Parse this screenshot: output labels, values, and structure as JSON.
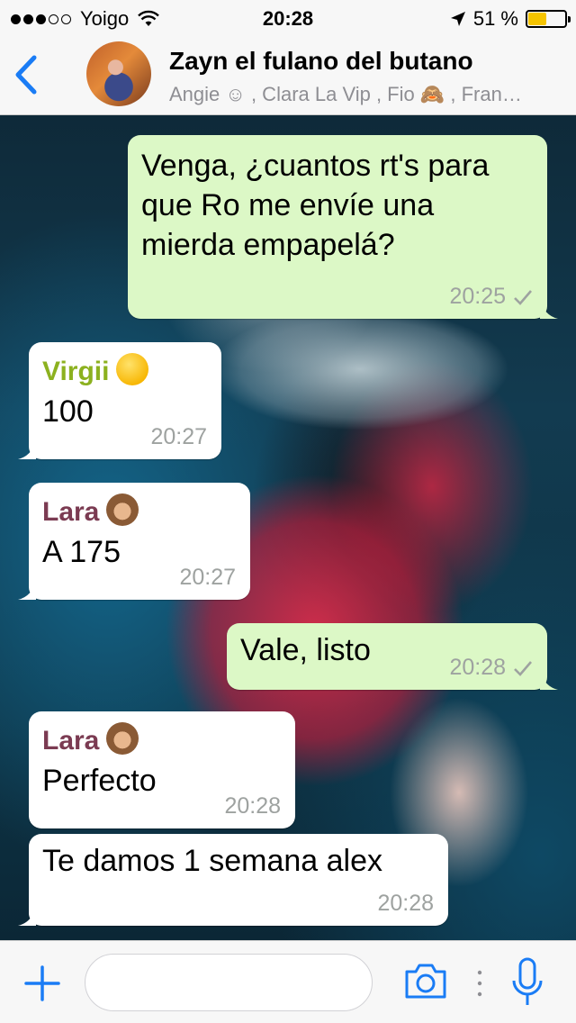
{
  "status_bar": {
    "carrier": "Yoigo",
    "time": "20:28",
    "battery_percent": "51 %",
    "battery_level": 0.51,
    "signal_bars_filled": 3,
    "signal_bars_total": 5
  },
  "header": {
    "title": "Zayn el fulano del butano",
    "participants": "Angie ☺︎ , Clara La Vip , Fio 🙈 , Fran…"
  },
  "messages": [
    {
      "direction": "out",
      "text": "Venga, ¿cuantos rt's para que Ro me envíe una mierda empapelá?",
      "time": "20:25",
      "status": "sent"
    },
    {
      "direction": "in",
      "sender": "Virgii",
      "sender_emoji": "smile",
      "sender_color": "#8cb11f",
      "text": "100",
      "time": "20:27"
    },
    {
      "direction": "in",
      "sender": "Lara",
      "sender_emoji": "see-no-evil-monkey",
      "sender_color": "#7b3b52",
      "text": "A 175",
      "time": "20:27"
    },
    {
      "direction": "out",
      "text": "Vale, listo",
      "time": "20:28",
      "status": "sent"
    },
    {
      "direction": "in",
      "sender": "Lara",
      "sender_emoji": "see-no-evil-monkey",
      "sender_color": "#7b3b52",
      "text": "Perfecto",
      "time": "20:28"
    },
    {
      "direction": "in",
      "text": "Te damos 1 semana alex",
      "time": "20:28"
    }
  ],
  "input": {
    "value": "",
    "placeholder": ""
  },
  "colors": {
    "accent": "#1a7cf5",
    "outgoing_bubble": "#dcf8c6",
    "incoming_bubble": "#ffffff"
  },
  "icons": [
    "back-chevron-icon",
    "plus-icon",
    "camera-icon",
    "microphone-icon",
    "check-icon",
    "location-arrow-icon",
    "wifi-icon"
  ]
}
